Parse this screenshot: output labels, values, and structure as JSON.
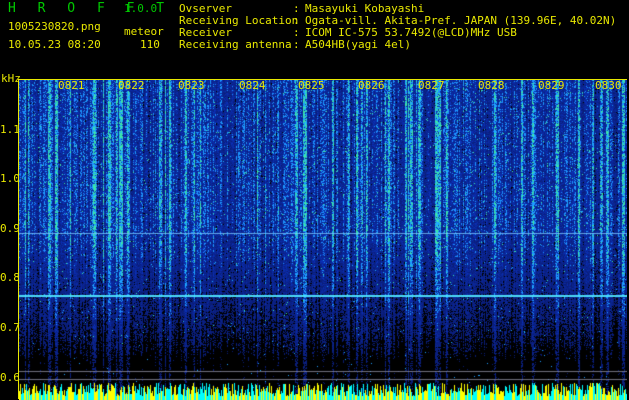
{
  "app": {
    "title": "H R O F F T",
    "version": "1.0.0"
  },
  "capture": {
    "file": "1005230820.png",
    "datetime": "10.05.23 08:20",
    "mode": "meteor",
    "count": "110"
  },
  "station": {
    "rows": [
      {
        "key": "Ovserver",
        "sep": ":",
        "value": "Masayuki Kobayashi"
      },
      {
        "key": "Receiving Location",
        "sep": ":",
        "value": "Ogata-vill. Akita-Pref. JAPAN (139.96E, 40.02N)"
      },
      {
        "key": "Receiver",
        "sep": ":",
        "value": "ICOM IC-575 53.7492(@LCD)MHz USB"
      },
      {
        "key": "Receiving antenna",
        "sep": ":",
        "value": "A504HB(yagi 4el)"
      }
    ]
  },
  "plot": {
    "y_unit": "kHz",
    "y_ticks": [
      "1.1",
      "1.0",
      "0.9",
      "0.8",
      "0.7",
      "0.6"
    ],
    "x_ticks": [
      "0821",
      "0822",
      "0823",
      "0824",
      "0825",
      "0826",
      "0827",
      "0828",
      "0829",
      "0830"
    ],
    "colors": {
      "axis": "#e8e800",
      "background": "#000000",
      "signal_low": "#0a1a8c",
      "signal_mid": "#2a5cff",
      "signal_high": "#30ffb0",
      "bottom_band": "#ffff00",
      "bottom_band_cyan": "#00ffff"
    }
  }
}
